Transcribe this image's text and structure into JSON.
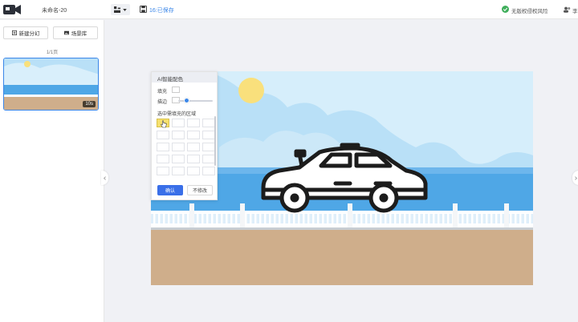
{
  "header": {
    "doc_title": "未命名-20",
    "save_status": "16:已保存",
    "copyright": "无版权侵权风险",
    "user": "李"
  },
  "left_panel": {
    "new_page_label": "新建分幻",
    "scene_label": "场景库",
    "page_count": "1/1页",
    "thumb_badge": "10s"
  },
  "ai_panel": {
    "title": "AI智能配色",
    "fill_label": "填充",
    "stroke_label": "描边",
    "hint": "选中需填充的区域",
    "confirm_label": "确认",
    "cancel_label": "不修改",
    "slider_value": 0.25
  },
  "colors": {
    "accent": "#3a86e8",
    "sky": "#b9e0f7",
    "sea": "#4fa7e6",
    "ground": "#cfae8b",
    "sun": "#f9e07c",
    "railing": "#ffffff"
  },
  "icons": [
    "camera-logo-icon",
    "tool-icon",
    "chevron-down-icon",
    "save-icon",
    "shield-check-icon",
    "user-icon",
    "add-icon",
    "image-icon",
    "cursor-hand-icon",
    "chevron-left-icon",
    "chevron-right-icon"
  ]
}
